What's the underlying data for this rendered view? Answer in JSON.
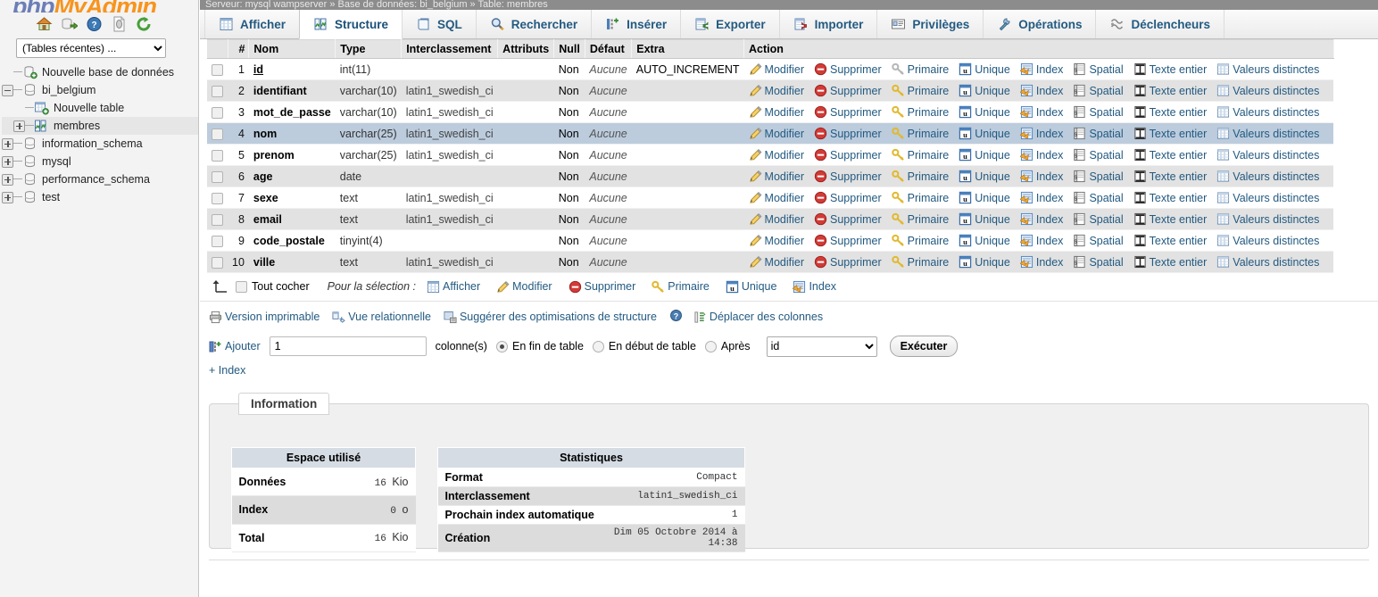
{
  "sidebar": {
    "logo": {
      "php": "php",
      "my": "My",
      "admin": "Admin"
    },
    "nav_icons": [
      "home-icon",
      "export-icon",
      "help-icon",
      "docs-icon",
      "reload-icon"
    ],
    "recent_select": "(Tables récentes) ...",
    "tree": [
      {
        "label": "Nouvelle base de données",
        "icon": "db-new-icon",
        "level": 0,
        "toggle": "none"
      },
      {
        "label": "bi_belgium",
        "icon": "db-icon",
        "level": 0,
        "toggle": "minus"
      },
      {
        "label": "Nouvelle table",
        "icon": "table-new-icon",
        "level": 1,
        "toggle": "none"
      },
      {
        "label": "membres",
        "icon": "table-struct-icon",
        "level": 1,
        "toggle": "plus",
        "selected": true
      },
      {
        "label": "information_schema",
        "icon": "db-icon",
        "level": 0,
        "toggle": "plus"
      },
      {
        "label": "mysql",
        "icon": "db-icon",
        "level": 0,
        "toggle": "plus"
      },
      {
        "label": "performance_schema",
        "icon": "db-icon",
        "level": 0,
        "toggle": "plus"
      },
      {
        "label": "test",
        "icon": "db-icon",
        "level": 0,
        "toggle": "plus"
      }
    ]
  },
  "breadcrumb": "Serveur: mysql wampserver  » Base de données: bi_belgium  » Table: membres",
  "tabs": [
    {
      "label": "Afficher",
      "icon": "browse-icon",
      "active": false
    },
    {
      "label": "Structure",
      "icon": "structure-icon",
      "active": true
    },
    {
      "label": "SQL",
      "icon": "sql-icon",
      "active": false
    },
    {
      "label": "Rechercher",
      "icon": "search-icon",
      "active": false
    },
    {
      "label": "Insérer",
      "icon": "insert-icon",
      "active": false
    },
    {
      "label": "Exporter",
      "icon": "export-icon",
      "active": false
    },
    {
      "label": "Importer",
      "icon": "import-icon",
      "active": false
    },
    {
      "label": "Privilèges",
      "icon": "privileges-icon",
      "active": false
    },
    {
      "label": "Opérations",
      "icon": "operations-icon",
      "active": false
    },
    {
      "label": "Déclencheurs",
      "icon": "triggers-icon",
      "active": false
    }
  ],
  "columns_table": {
    "headers": [
      "",
      "#",
      "Nom",
      "Type",
      "Interclassement",
      "Attributs",
      "Null",
      "Défaut",
      "Extra",
      "Action"
    ],
    "rows": [
      {
        "num": "1",
        "name": "id",
        "primary": true,
        "type": "int(11)",
        "collation": "",
        "attributes": "",
        "null": "Non",
        "default": "Aucune",
        "extra": "AUTO_INCREMENT",
        "highlight": false,
        "primary_disabled": true
      },
      {
        "num": "2",
        "name": "identifiant",
        "primary": false,
        "type": "varchar(10)",
        "collation": "latin1_swedish_ci",
        "attributes": "",
        "null": "Non",
        "default": "Aucune",
        "extra": "",
        "highlight": false,
        "primary_disabled": false
      },
      {
        "num": "3",
        "name": "mot_de_passe",
        "primary": false,
        "type": "varchar(10)",
        "collation": "latin1_swedish_ci",
        "attributes": "",
        "null": "Non",
        "default": "Aucune",
        "extra": "",
        "highlight": false,
        "primary_disabled": false
      },
      {
        "num": "4",
        "name": "nom",
        "primary": false,
        "type": "varchar(25)",
        "collation": "latin1_swedish_ci",
        "attributes": "",
        "null": "Non",
        "default": "Aucune",
        "extra": "",
        "highlight": true,
        "primary_disabled": false
      },
      {
        "num": "5",
        "name": "prenom",
        "primary": false,
        "type": "varchar(25)",
        "collation": "latin1_swedish_ci",
        "attributes": "",
        "null": "Non",
        "default": "Aucune",
        "extra": "",
        "highlight": false,
        "primary_disabled": false
      },
      {
        "num": "6",
        "name": "age",
        "primary": false,
        "type": "date",
        "collation": "",
        "attributes": "",
        "null": "Non",
        "default": "Aucune",
        "extra": "",
        "highlight": false,
        "primary_disabled": false
      },
      {
        "num": "7",
        "name": "sexe",
        "primary": false,
        "type": "text",
        "collation": "latin1_swedish_ci",
        "attributes": "",
        "null": "Non",
        "default": "Aucune",
        "extra": "",
        "highlight": false,
        "primary_disabled": false
      },
      {
        "num": "8",
        "name": "email",
        "primary": false,
        "type": "text",
        "collation": "latin1_swedish_ci",
        "attributes": "",
        "null": "Non",
        "default": "Aucune",
        "extra": "",
        "highlight": false,
        "primary_disabled": false
      },
      {
        "num": "9",
        "name": "code_postale",
        "primary": false,
        "type": "tinyint(4)",
        "collation": "",
        "attributes": "",
        "null": "Non",
        "default": "Aucune",
        "extra": "",
        "highlight": false,
        "primary_disabled": false
      },
      {
        "num": "10",
        "name": "ville",
        "primary": false,
        "type": "text",
        "collation": "latin1_swedish_ci",
        "attributes": "",
        "null": "Non",
        "default": "Aucune",
        "extra": "",
        "highlight": false,
        "primary_disabled": false
      }
    ],
    "row_actions": [
      {
        "label": "Modifier",
        "icon": "pencil-icon"
      },
      {
        "label": "Supprimer",
        "icon": "delete-icon"
      },
      {
        "label": "Primaire",
        "icon": "key-icon"
      },
      {
        "label": "Unique",
        "icon": "unique-icon"
      },
      {
        "label": "Index",
        "icon": "index-icon"
      },
      {
        "label": "Spatial",
        "icon": "spatial-icon"
      },
      {
        "label": "Texte entier",
        "icon": "fulltext-icon"
      },
      {
        "label": "Valeurs distinctes",
        "icon": "distinct-icon"
      }
    ]
  },
  "selection_toolbar": {
    "check_all": "Tout cocher",
    "for_selection": "Pour la sélection :",
    "actions": [
      {
        "label": "Afficher",
        "icon": "browse-icon"
      },
      {
        "label": "Modifier",
        "icon": "pencil-icon"
      },
      {
        "label": "Supprimer",
        "icon": "delete-icon"
      },
      {
        "label": "Primaire",
        "icon": "key-icon"
      },
      {
        "label": "Unique",
        "icon": "unique-icon"
      },
      {
        "label": "Index",
        "icon": "index-icon"
      }
    ]
  },
  "links_row": [
    {
      "label": "Version imprimable",
      "icon": "print-icon"
    },
    {
      "label": "Vue relationnelle",
      "icon": "relation-icon"
    },
    {
      "label": "Suggérer des optimisations de structure",
      "icon": "optimize-icon"
    },
    {
      "label": "Déplacer des colonnes",
      "icon": "move-columns-icon"
    }
  ],
  "add_row": {
    "icon": "add-column-icon",
    "label": "Ajouter",
    "count_value": "1",
    "columns_label": "colonne(s)",
    "options": [
      {
        "label": "En fin de table",
        "checked": true
      },
      {
        "label": "En début de table",
        "checked": false
      },
      {
        "label": "Après",
        "checked": false
      }
    ],
    "after_select": "id",
    "execute_label": "Exécuter"
  },
  "index_link": "+ Index",
  "information": {
    "legend": "Information",
    "space_used": {
      "caption": "Espace utilisé",
      "rows": [
        {
          "key": "Données",
          "num": "16",
          "unit": "Kio"
        },
        {
          "key": "Index",
          "num": "0",
          "unit": "o"
        },
        {
          "key": "Total",
          "num": "16",
          "unit": "Kio"
        }
      ]
    },
    "statistics": {
      "caption": "Statistiques",
      "rows": [
        {
          "key": "Format",
          "value": "Compact"
        },
        {
          "key": "Interclassement",
          "value": "latin1_swedish_ci"
        },
        {
          "key": "Prochain index automatique",
          "value": "1"
        },
        {
          "key": "Création",
          "value": "Dim 05 Octobre 2014 à 14:38"
        }
      ]
    }
  },
  "colors": {
    "link": "#235a81",
    "highlight_row": "#bcccdd",
    "header_bg": "#e4e4e4",
    "caption_bg": "#d5dce4",
    "brand_orange": "#f7941e",
    "brand_blue": "#6c7eb7"
  }
}
